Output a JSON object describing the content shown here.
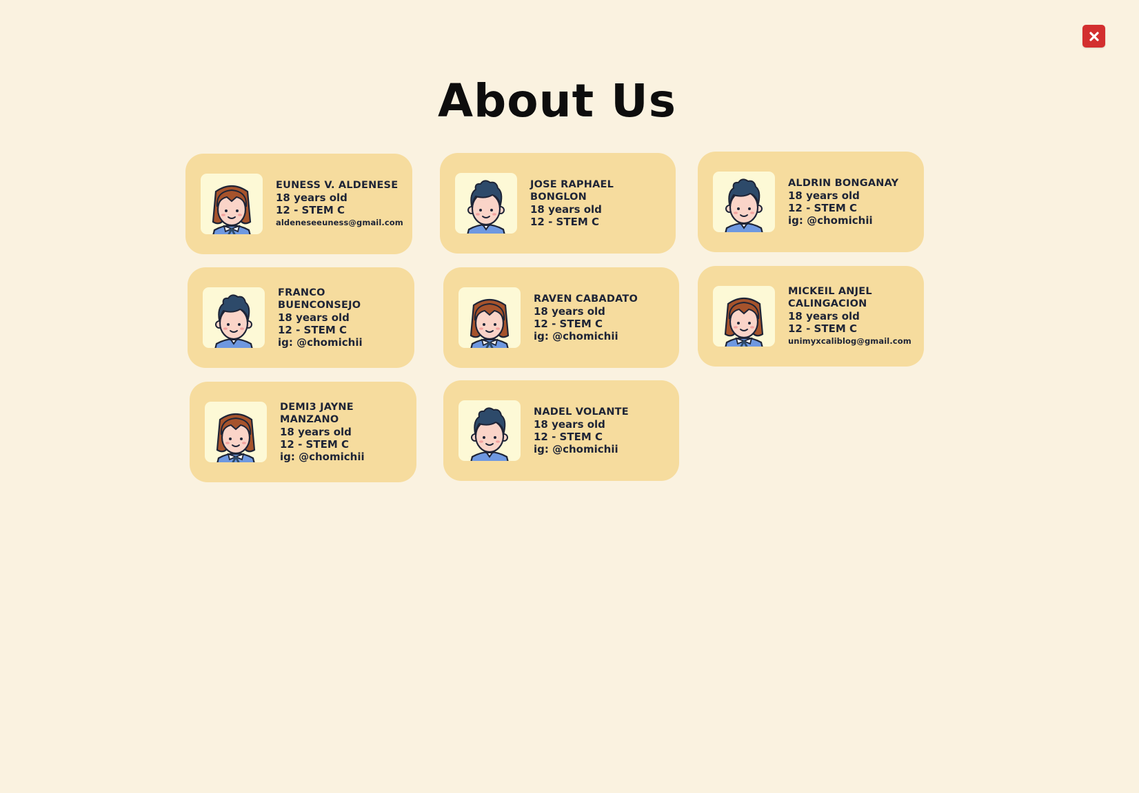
{
  "header": {
    "title": "About Us",
    "close_icon": "close-x-icon"
  },
  "colors": {
    "background": "#faf2e0",
    "card": "#f6dc9e",
    "avatar_bg": "#fdf9d6",
    "close_button": "#d32f2f",
    "text": "#1e2436"
  },
  "members": [
    {
      "name_lines": [
        "EUNESS V. ALDENESE"
      ],
      "info": [
        "18 years old",
        "12 - STEM C",
        "aldeneseeuness@gmail.com"
      ],
      "avatar": "girl-avatar-icon"
    },
    {
      "name_lines": [
        "JOSE RAPHAEL",
        "BONGLON"
      ],
      "info": [
        "18 years old",
        "12 - STEM C"
      ],
      "avatar": "boy-avatar-icon"
    },
    {
      "name_lines": [
        "ALDRIN BONGANAY"
      ],
      "info": [
        "18 years old",
        "12 - STEM C",
        "ig: @chomichii"
      ],
      "avatar": "boy-avatar-icon"
    },
    {
      "name_lines": [
        "FRANCO",
        "BUENCONSEJO"
      ],
      "info": [
        "18 years old",
        "12 - STEM C",
        "ig: @chomichii"
      ],
      "avatar": "boy-avatar-icon"
    },
    {
      "name_lines": [
        "RAVEN CABADATO"
      ],
      "info": [
        "18 years old",
        "12 - STEM C",
        "ig: @chomichii"
      ],
      "avatar": "girl-avatar-icon"
    },
    {
      "name_lines": [
        "MICKEIL ANJEL",
        "CALINGACION"
      ],
      "info": [
        "18 years old",
        "12 - STEM C",
        "unimyxcaliblog@gmail.com"
      ],
      "avatar": "girl-avatar-icon"
    },
    {
      "name_lines": [
        "DEMI3 JAYNE",
        "MANZANO"
      ],
      "info": [
        "18 years old",
        "12 - STEM C",
        "ig: @chomichii"
      ],
      "avatar": "girl-avatar-icon"
    },
    {
      "name_lines": [
        "NADEL VOLANTE"
      ],
      "info": [
        "18 years old",
        "12 - STEM C",
        "ig: @chomichii"
      ],
      "avatar": "boy-avatar-icon"
    }
  ]
}
